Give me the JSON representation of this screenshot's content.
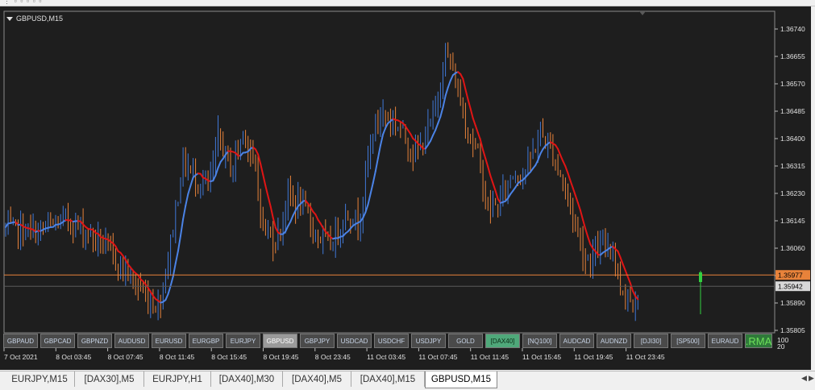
{
  "chart_title": "GBPUSD,M15",
  "price_labels": [
    "1.36740",
    "1.36655",
    "1.36570",
    "1.36485",
    "1.36400",
    "1.36315",
    "1.36230",
    "1.36145",
    "1.36060",
    "1.35975",
    "1.35890",
    "1.35805"
  ],
  "price_levels": [
    1.3674,
    1.36655,
    1.3657,
    1.36485,
    1.364,
    1.36315,
    1.3623,
    1.36145,
    1.3606,
    1.35975,
    1.3589,
    1.35805
  ],
  "orange_line": {
    "label": "1.35977",
    "value": 1.35977,
    "color": "#e8823a"
  },
  "current_price": {
    "label": "1.35942",
    "value": 1.35942
  },
  "time_labels": [
    "7 Oct 2021",
    "8 Oct 03:45",
    "8 Oct 07:45",
    "8 Oct 11:45",
    "8 Oct 15:45",
    "8 Oct 19:45",
    "8 Oct 23:45",
    "11 Oct 03:45",
    "11 Oct 07:45",
    "11 Oct 11:45",
    "11 Oct 15:45",
    "11 Oct 19:45",
    "11 Oct 23:45"
  ],
  "indicator_labels": {
    "top": "100",
    "bottom": "20"
  },
  "symbols": [
    {
      "label": "GBPAUD",
      "state": "normal"
    },
    {
      "label": "GBPCAD",
      "state": "normal"
    },
    {
      "label": "GBPNZD",
      "state": "normal"
    },
    {
      "label": "AUDUSD",
      "state": "normal"
    },
    {
      "label": "EURUSD",
      "state": "normal"
    },
    {
      "label": "EURGBP",
      "state": "normal"
    },
    {
      "label": "EURJPY",
      "state": "normal"
    },
    {
      "label": "GBPUSD",
      "state": "active"
    },
    {
      "label": "GBPJPY",
      "state": "normal"
    },
    {
      "label": "USDCAD",
      "state": "normal"
    },
    {
      "label": "USDCHF",
      "state": "normal"
    },
    {
      "label": "USDJPY",
      "state": "normal"
    },
    {
      "label": "GOLD",
      "state": "normal"
    },
    {
      "label": "[DAX40]",
      "state": "green"
    },
    {
      "label": "[NQ100]",
      "state": "normal"
    },
    {
      "label": "AUDCAD",
      "state": "normal"
    },
    {
      "label": "AUDNZD",
      "state": "normal"
    },
    {
      "label": "[DJI30]",
      "state": "normal"
    },
    {
      "label": "[SP500]",
      "state": "normal"
    },
    {
      "label": "EURAUD",
      "state": "normal"
    },
    {
      "label": ".RMA",
      "state": "rma"
    }
  ],
  "tabs": [
    {
      "label": "EURJPY,M15",
      "active": false
    },
    {
      "label": "[DAX30],M5",
      "active": false
    },
    {
      "label": "EURJPY,H1",
      "active": false
    },
    {
      "label": "[DAX40],M30",
      "active": false
    },
    {
      "label": "[DAX40],M5",
      "active": false
    },
    {
      "label": "[DAX40],M15",
      "active": false
    },
    {
      "label": "GBPUSD,M15",
      "active": true
    }
  ],
  "colors": {
    "background": "#1e1e1e",
    "bull": "#3f78d8",
    "bear": "#e8823a",
    "ma_up": "#4b83e6",
    "ma_down": "#e01515",
    "grid_text": "#e0e0e0"
  },
  "chart_data": {
    "type": "candlestick",
    "symbol": "GBPUSD",
    "timeframe": "M15",
    "ylim": [
      1.35785,
      1.368
    ],
    "key_points": [
      {
        "t": "7 Oct 2021",
        "price": 1.3612
      },
      {
        "t": "8 Oct 07:45",
        "price": 1.3588
      },
      {
        "t": "8 Oct 11:45",
        "price": 1.3634
      },
      {
        "t": "8 Oct 15:45",
        "price": 1.3643
      },
      {
        "t": "8 Oct 19:45",
        "price": 1.362
      },
      {
        "t": "8 Oct 23:45",
        "price": 1.3612
      },
      {
        "t": "11 Oct 03:45",
        "price": 1.3648
      },
      {
        "t": "11 Oct 07:45",
        "price": 1.367
      },
      {
        "t": "11 Oct 11:45",
        "price": 1.3615
      },
      {
        "t": "11 Oct 15:45",
        "price": 1.364
      },
      {
        "t": "11 Oct 19:45",
        "price": 1.3605
      },
      {
        "t": "11 Oct 23:45",
        "price": 1.3594
      }
    ]
  }
}
